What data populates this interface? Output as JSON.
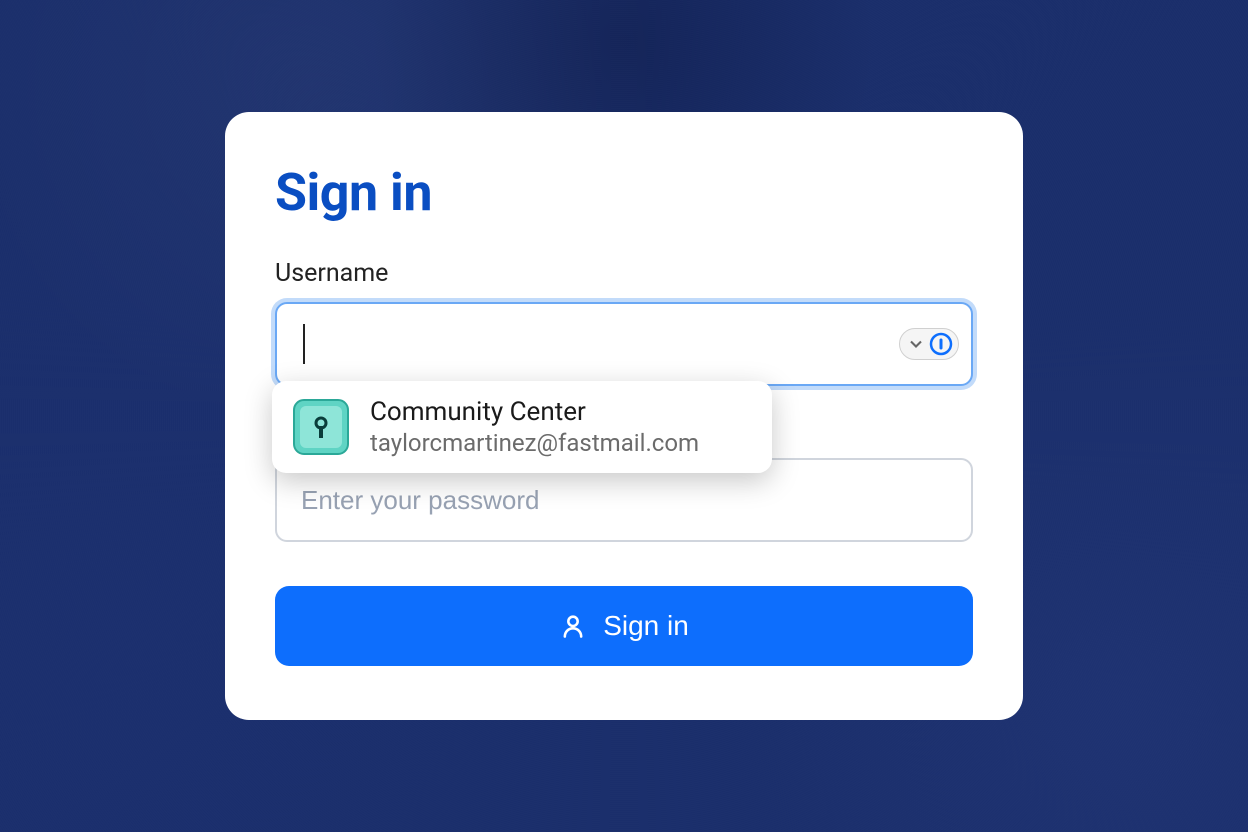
{
  "form": {
    "title": "Sign in",
    "username_label": "Username",
    "username_value": "",
    "password_placeholder": "Enter your password",
    "password_value": "",
    "submit_label": "Sign in"
  },
  "autofill": {
    "title": "Community Center",
    "subtitle": "taylorcmartinez@fastmail.com"
  },
  "colors": {
    "primary": "#0d6efd",
    "title": "#0a4ec2",
    "background": "#1a2e6b",
    "focus_ring": "#6aa8f5"
  }
}
